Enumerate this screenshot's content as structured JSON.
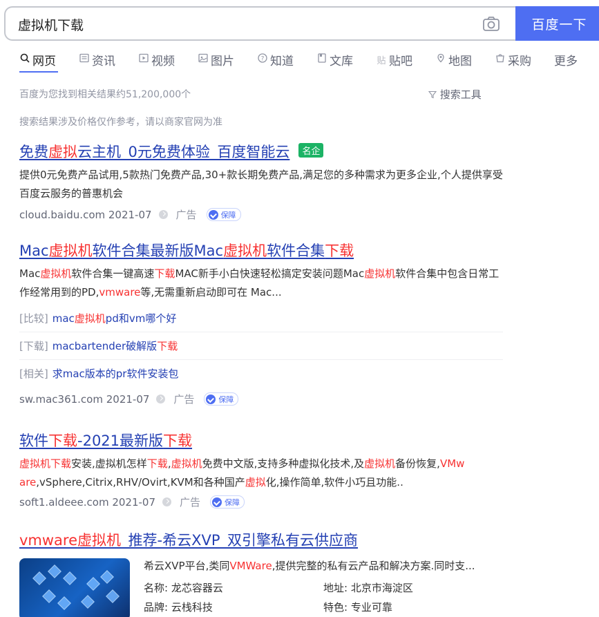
{
  "search": {
    "query": "虚拟机下载",
    "button_label": "百度一下"
  },
  "tabs": [
    {
      "icon": "search-icon",
      "label": "网页"
    },
    {
      "icon": "news-icon",
      "label": "资讯"
    },
    {
      "icon": "video-icon",
      "label": "视频"
    },
    {
      "icon": "image-icon",
      "label": "图片"
    },
    {
      "icon": "question-icon",
      "label": "知道"
    },
    {
      "icon": "doc-icon",
      "label": "文库"
    },
    {
      "icon": "tieba-icon",
      "label": "贴吧"
    },
    {
      "icon": "map-icon",
      "label": "地图"
    },
    {
      "icon": "purchase-icon",
      "label": "采购"
    },
    {
      "icon": "",
      "label": "更多"
    }
  ],
  "result_count": "百度为您找到相关结果约51,200,000个",
  "search_tools": "搜索工具",
  "price_notice": "搜索结果涉及价格仅作参考，请以商家官网为准",
  "results": [
    {
      "title_parts": [
        "免费",
        "虚拟",
        "云主机_0元免费体验_百度智能云"
      ],
      "badge": "名企",
      "desc": "提供0元免费产品试用,5款热门免费产品,30+款长期免费产品,满足您的多种需求为更多企业,个人提供享受百度云服务的普惠机会",
      "source": "cloud.baidu.com 2021-07",
      "ad": "广告",
      "guarantee": "保障"
    },
    {
      "title_parts": [
        "Mac",
        "虚拟机",
        "软件合集最新版Mac",
        "虚拟机",
        "软件合集",
        "下载"
      ],
      "desc_parts": [
        "Mac",
        "虚拟机",
        "软件合集一键高速",
        "下载",
        "MAC新手小白快速轻松搞定安装问题Mac",
        "虚拟机",
        "软件合集中包含日常工作经常用到的PD,",
        "vmware",
        "等,无需重新启动即可在 Mac..."
      ],
      "sublinks": [
        {
          "tag": "[比较]",
          "parts": [
            "mac",
            "虚拟机",
            "pd和vm哪个好"
          ]
        },
        {
          "tag": "[下载]",
          "parts": [
            "macbartender破解版",
            "下载"
          ]
        },
        {
          "tag": "[相关]",
          "parts": [
            "求mac版本的pr软件安装包"
          ]
        }
      ],
      "source": "sw.mac361.com 2021-07",
      "ad": "广告",
      "guarantee": "保障"
    },
    {
      "title_parts": [
        "软件",
        "下载",
        "-2021最新版",
        "下载"
      ],
      "desc_line1": [
        "虚拟机下载",
        "安装,虚拟机怎样",
        "下载",
        ",",
        "虚拟机",
        "免费中文版,支持多种虚拟化技术,及",
        "虚拟机",
        "备份恢复,",
        "VMw"
      ],
      "desc_line2": [
        "are",
        ",vSphere,Citrix,RHV/Ovirt,KVM和各种国产",
        "虚拟",
        "化,操作简单,软件小巧且功能.."
      ],
      "source": "soft1.aldeee.com 2021-07",
      "ad": "广告",
      "guarantee": "保障"
    },
    {
      "title_parts": [
        "vmware",
        "虚拟机",
        "_推荐-希云XVP_双引擎私有云供应商"
      ],
      "desc_parts": [
        "希云XVP平台,类同",
        "VMWare",
        ",提供完整的私有云产品和解决方案.同时支..."
      ],
      "info": {
        "name_key": "名称:",
        "name_val": "龙芯容器云",
        "addr_key": "地址:",
        "addr_val": "北京市海淀区",
        "brand_key": "品牌:",
        "brand_val": "云栈科技",
        "feat_key": "特色:",
        "feat_val": "专业可靠"
      }
    }
  ],
  "colors": {
    "brand_blue": "#4e6ef2",
    "link_blue": "#2440b3",
    "highlight_red": "#f73131",
    "badge_green": "#1cb365"
  }
}
